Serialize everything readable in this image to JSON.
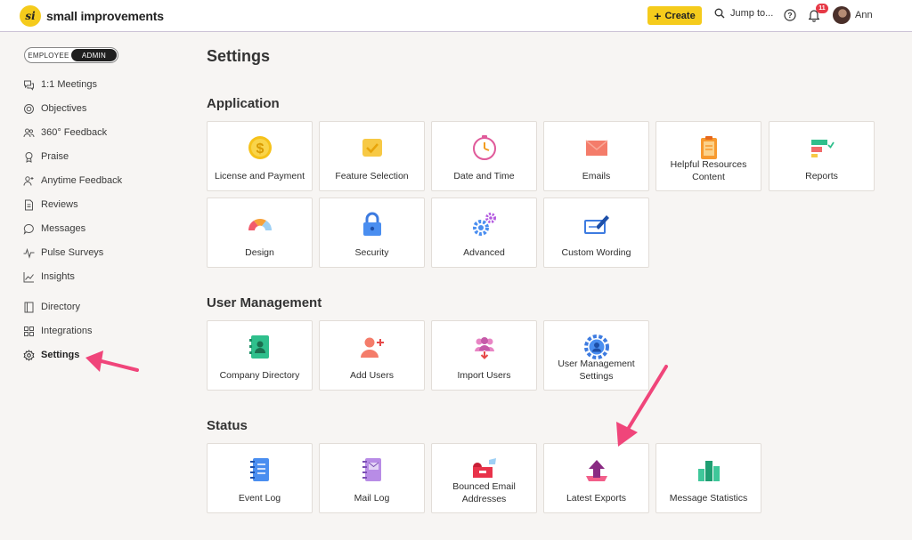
{
  "app": {
    "logo_mark": "si",
    "brand": "small improvements",
    "create_label": "Create",
    "jump_label": "Jump to...",
    "notifications_count": "11",
    "user_name": "Ann"
  },
  "sidebar": {
    "toggle": {
      "employee": "EMPLOYEE",
      "admin": "ADMIN",
      "selected": "ADMIN"
    },
    "items": [
      {
        "label": "1:1 Meetings",
        "icon": "chat-bubbles-icon"
      },
      {
        "label": "Objectives",
        "icon": "target-icon"
      },
      {
        "label": "360° Feedback",
        "icon": "people-icon"
      },
      {
        "label": "Praise",
        "icon": "ribbon-icon"
      },
      {
        "label": "Anytime Feedback",
        "icon": "person-feedback-icon"
      },
      {
        "label": "Reviews",
        "icon": "document-icon"
      },
      {
        "label": "Messages",
        "icon": "message-icon"
      },
      {
        "label": "Pulse Surveys",
        "icon": "pulse-icon"
      },
      {
        "label": "Insights",
        "icon": "chart-icon"
      },
      {
        "label": "Directory",
        "icon": "directory-icon"
      },
      {
        "label": "Integrations",
        "icon": "grid-icon"
      },
      {
        "label": "Settings",
        "icon": "gear-icon",
        "active": true
      }
    ]
  },
  "main": {
    "title": "Settings",
    "sections": [
      {
        "title": "Application",
        "cards": [
          {
            "label": "License and Payment",
            "icon": "dollar-coin-icon"
          },
          {
            "label": "Feature Selection",
            "icon": "checkbox-icon"
          },
          {
            "label": "Date and Time",
            "icon": "clock-icon"
          },
          {
            "label": "Emails",
            "icon": "envelope-icon"
          },
          {
            "label": "Helpful Resources Content",
            "icon": "clipboard-icon"
          },
          {
            "label": "Reports",
            "icon": "report-bars-icon"
          },
          {
            "label": "Design",
            "icon": "color-gauge-icon"
          },
          {
            "label": "Security",
            "icon": "padlock-icon"
          },
          {
            "label": "Advanced",
            "icon": "gears-icon"
          },
          {
            "label": "Custom Wording",
            "icon": "pen-card-icon"
          }
        ]
      },
      {
        "title": "User Management",
        "cards": [
          {
            "label": "Company Directory",
            "icon": "address-book-icon"
          },
          {
            "label": "Add Users",
            "icon": "add-user-icon"
          },
          {
            "label": "Import Users",
            "icon": "import-users-icon"
          },
          {
            "label": "User Management Settings",
            "icon": "user-gear-icon"
          }
        ]
      },
      {
        "title": "Status",
        "cards": [
          {
            "label": "Event Log",
            "icon": "event-log-icon"
          },
          {
            "label": "Mail Log",
            "icon": "mail-log-icon"
          },
          {
            "label": "Bounced Email Addresses",
            "icon": "mailbox-icon"
          },
          {
            "label": "Latest Exports",
            "icon": "export-arrow-icon"
          },
          {
            "label": "Message Statistics",
            "icon": "statistics-bars-icon"
          }
        ]
      }
    ]
  },
  "colors": {
    "accent_yellow": "#f5cb1c",
    "annotation_pink": "#f0457a",
    "badge_red": "#e63946",
    "background": "#f7f5f3"
  }
}
